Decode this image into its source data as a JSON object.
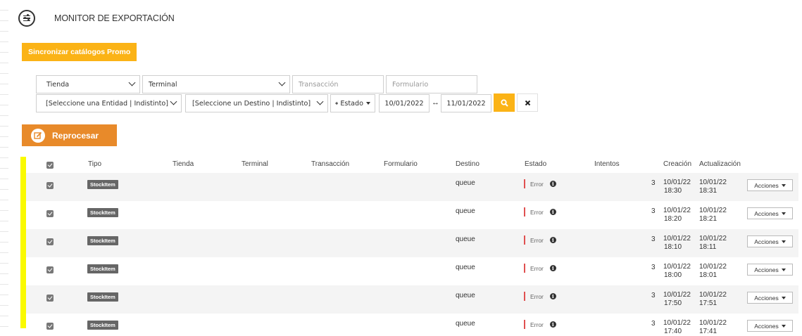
{
  "header": {
    "title": "MONITOR DE EXPORTACIÓN",
    "menu_icon": "sliders-icon"
  },
  "sync_button": {
    "label": "Sincronizar catálogos Promo"
  },
  "filters": {
    "tienda": {
      "value": "Tienda"
    },
    "terminal": {
      "value": "Terminal"
    },
    "transaccion": {
      "placeholder": "Transacción"
    },
    "formulario": {
      "placeholder": "Formulario"
    },
    "entidad": {
      "value": "[Seleccione una Entidad | Indistinto]"
    },
    "destino": {
      "value": "[Seleccione un Destino | Indistinto]"
    },
    "estado": {
      "label": "Estado"
    },
    "date_from": "10/01/2022",
    "date_sep": "↔",
    "date_to": "11/01/2022"
  },
  "reprocess_button": {
    "label": "Reprocesar"
  },
  "table": {
    "columns": {
      "tipo": "Tipo",
      "tienda": "Tienda",
      "terminal": "Terminal",
      "transaccion": "Transacción",
      "formulario": "Formulario",
      "destino": "Destino",
      "estado": "Estado",
      "intentos": "Intentos",
      "creacion": "Creación",
      "actualizacion": "Actualización"
    },
    "rows": [
      {
        "tipo": "StockItem",
        "destino": "queue",
        "estado": "Error",
        "intentos": "3",
        "creacion_date": "10/01/22",
        "creacion_time": "18:30",
        "actualizacion_date": "10/01/22",
        "actualizacion_time": "18:31",
        "actions": "Acciones"
      },
      {
        "tipo": "StockItem",
        "destino": "queue",
        "estado": "Error",
        "intentos": "3",
        "creacion_date": "10/01/22",
        "creacion_time": "18:20",
        "actualizacion_date": "10/01/22",
        "actualizacion_time": "18:21",
        "actions": "Acciones"
      },
      {
        "tipo": "StockItem",
        "destino": "queue",
        "estado": "Error",
        "intentos": "3",
        "creacion_date": "10/01/22",
        "creacion_time": "18:10",
        "actualizacion_date": "10/01/22",
        "actualizacion_time": "18:11",
        "actions": "Acciones"
      },
      {
        "tipo": "StockItem",
        "destino": "queue",
        "estado": "Error",
        "intentos": "3",
        "creacion_date": "10/01/22",
        "creacion_time": "18:00",
        "actualizacion_date": "10/01/22",
        "actualizacion_time": "18:01",
        "actions": "Acciones"
      },
      {
        "tipo": "StockItem",
        "destino": "queue",
        "estado": "Error",
        "intentos": "3",
        "creacion_date": "10/01/22",
        "creacion_time": "17:50",
        "actualizacion_date": "10/01/22",
        "actualizacion_time": "17:51",
        "actions": "Acciones"
      },
      {
        "tipo": "StockItem",
        "destino": "queue",
        "estado": "Error",
        "intentos": "3",
        "creacion_date": "10/01/22",
        "creacion_time": "17:40",
        "actualizacion_date": "10/01/22",
        "actualizacion_time": "17:41",
        "actions": "Acciones"
      }
    ]
  },
  "colors": {
    "accent": "#fbb316",
    "reprocess": "#e88a2a",
    "error": "#e05050",
    "highlight": "#fafa00",
    "badge": "#666666"
  }
}
